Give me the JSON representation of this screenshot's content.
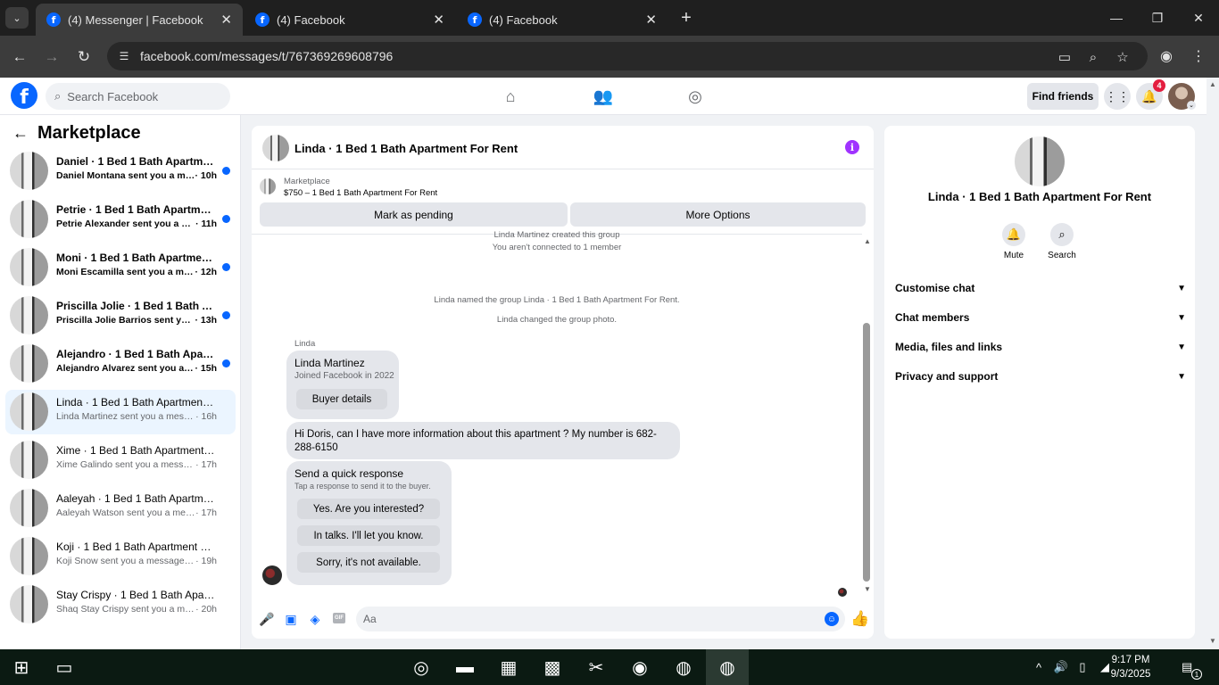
{
  "browser": {
    "tabs": [
      {
        "title": "(4) Messenger | Facebook",
        "active": true
      },
      {
        "title": "(4) Facebook",
        "active": false
      },
      {
        "title": "(4) Facebook",
        "active": false
      }
    ],
    "url": "facebook.com/messages/t/767369269608796"
  },
  "header": {
    "search_placeholder": "Search Facebook",
    "find_friends": "Find friends",
    "notification_count": "4"
  },
  "sidebar": {
    "title": "Marketplace",
    "conversations": [
      {
        "title": "Daniel · 1 Bed 1 Bath Apartment ...",
        "subtitle": "Daniel Montana sent you a messa...",
        "time": "· 10h",
        "unread": true
      },
      {
        "title": "Petrie · 1 Bed 1 Bath Apartment F...",
        "subtitle": "Petrie Alexander sent you a mess...",
        "time": "· 11h",
        "unread": true
      },
      {
        "title": "Moni · 1 Bed 1 Bath Apartment F...",
        "subtitle": "Moni Escamilla sent you a messa...",
        "time": "· 12h",
        "unread": true
      },
      {
        "title": "Priscilla Jolie · 1 Bed 1 Bath Apart...",
        "subtitle": "Priscilla Jolie Barrios sent you a m...",
        "time": "· 13h",
        "unread": true
      },
      {
        "title": "Alejandro · 1 Bed 1 Bath Apartme...",
        "subtitle": "Alejandro Alvarez sent you a mes...",
        "time": "· 15h",
        "unread": true
      },
      {
        "title": "Linda · 1 Bed 1 Bath Apartment For...",
        "subtitle": "Linda Martinez sent you a message a...",
        "time": "· 16h",
        "unread": false,
        "selected": true
      },
      {
        "title": "Xime · 1 Bed 1 Bath Apartment For...",
        "subtitle": "Xime Galindo sent you a message ab...",
        "time": "· 17h",
        "unread": false
      },
      {
        "title": "Aaleyah · 1 Bed 1 Bath Apartment ...",
        "subtitle": "Aaleyah Watson sent you a message ...",
        "time": "· 17h",
        "unread": false
      },
      {
        "title": "Koji · 1 Bed 1 Bath Apartment For ...",
        "subtitle": "Koji Snow sent you a message about...",
        "time": "· 19h",
        "unread": false
      },
      {
        "title": "Stay Crispy · 1 Bed 1 Bath Apartme...",
        "subtitle": "Shaq Stay Crispy sent you a message...",
        "time": "· 20h",
        "unread": false
      }
    ]
  },
  "chat": {
    "title": "Linda · 1 Bed 1 Bath Apartment For Rent",
    "listing_label": "Marketplace",
    "listing_price": "$750 – 1 Bed 1 Bath Apartment For Rent",
    "mark_pending": "Mark as pending",
    "more_options": "More Options",
    "system_lines": [
      "Linda Martinez created this group",
      "You aren't connected to 1 member",
      "Linda named the group Linda · 1 Bed 1 Bath Apartment For Rent.",
      "Linda changed the group photo."
    ],
    "sender": "Linda",
    "profile_card": {
      "name": "Linda Martinez",
      "joined": "Joined Facebook in 2022",
      "button": "Buyer details"
    },
    "message_text": "Hi Doris, can I have more information about this apartment ? My number is 682-288-6150",
    "quick_response": {
      "title": "Send a quick response",
      "subtitle": "Tap a response to send it to the buyer.",
      "options": [
        "Yes. Are you interested?",
        "In talks. I'll let you know.",
        "Sorry, it's not available."
      ]
    },
    "composer_placeholder": "Aa"
  },
  "info_panel": {
    "title": "Linda · 1 Bed 1 Bath Apartment For Rent",
    "actions": [
      {
        "label": "Mute",
        "icon": "bell-icon"
      },
      {
        "label": "Search",
        "icon": "search-icon"
      }
    ],
    "sections": [
      "Customise chat",
      "Chat members",
      "Media, files and links",
      "Privacy and support"
    ]
  },
  "taskbar": {
    "time": "9:17 PM",
    "date": "9/3/2025",
    "notification_count": "1"
  },
  "colors": {
    "fb_blue": "#0866ff",
    "unread_dot": "#0866ff",
    "info_purple": "#a033ff",
    "badge_red": "#e41e3f"
  }
}
